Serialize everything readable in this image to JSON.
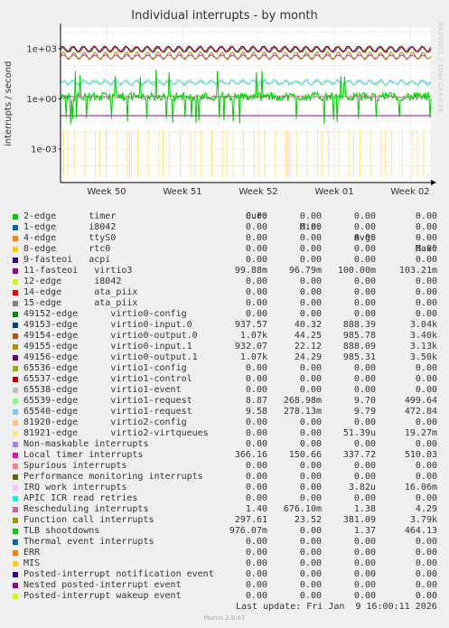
{
  "chart_data": {
    "type": "line",
    "title": "Individual interrupts - by month",
    "side_text": "RRDTOOL / TOBI OETIKER",
    "ylabel": "interrupts / second",
    "yscale": "log",
    "ylim": [
      1e-05,
      20000
    ],
    "y_ticks": [
      {
        "value": 1000,
        "label": "1e+03"
      },
      {
        "value": 1,
        "label": "1e+00"
      },
      {
        "value": 0.001,
        "label": "1e-03"
      }
    ],
    "x_ticks": [
      "Week 50",
      "Week 51",
      "Week 52",
      "Week 01",
      "Week 02"
    ],
    "grid": true,
    "columns": [
      "Cur:",
      "Min:",
      "Avg:",
      "Max:"
    ],
    "series": [
      {
        "name": "2-edge      timer",
        "color": "#00cc00",
        "cur": "0.00",
        "min": "0.00",
        "avg": "0.00",
        "max": "0.00"
      },
      {
        "name": "1-edge      i8042",
        "color": "#0066b3",
        "cur": "0.00",
        "min": "0.00",
        "avg": "0.00",
        "max": "0.00"
      },
      {
        "name": "4-edge      ttyS0",
        "color": "#ff8000",
        "cur": "0.00",
        "min": "0.00",
        "avg": "0.00",
        "max": "0.00"
      },
      {
        "name": "8-edge      rtc0",
        "color": "#ffcc00",
        "cur": "0.00",
        "min": "0.00",
        "avg": "0.00",
        "max": "0.00"
      },
      {
        "name": "9-fasteoi   acpi",
        "color": "#330099",
        "cur": "0.00",
        "min": "0.00",
        "avg": "0.00",
        "max": "0.00"
      },
      {
        "name": "11-fasteoi   virtio3",
        "color": "#990099",
        "cur": "99.88m",
        "min": "96.79m",
        "avg": "100.00m",
        "max": "103.21m"
      },
      {
        "name": "12-edge      i8042",
        "color": "#ccff00",
        "cur": "0.00",
        "min": "0.00",
        "avg": "0.00",
        "max": "0.00"
      },
      {
        "name": "14-edge      ata_piix",
        "color": "#ff0000",
        "cur": "0.00",
        "min": "0.00",
        "avg": "0.00",
        "max": "0.00"
      },
      {
        "name": "15-edge      ata_piix",
        "color": "#808080",
        "cur": "0.00",
        "min": "0.00",
        "avg": "0.00",
        "max": "0.00"
      },
      {
        "name": "49152-edge      virtio0-config",
        "color": "#008f00",
        "cur": "0.00",
        "min": "0.00",
        "avg": "0.00",
        "max": "0.00"
      },
      {
        "name": "49153-edge      virtio0-input.0",
        "color": "#00487d",
        "cur": "937.57",
        "min": "40.32",
        "avg": "888.39",
        "max": "3.04k"
      },
      {
        "name": "49154-edge      virtio0-output.0",
        "color": "#b35a00",
        "cur": "1.07k",
        "min": "44.25",
        "avg": "985.78",
        "max": "3.40k"
      },
      {
        "name": "49155-edge      virtio0-input.1",
        "color": "#b38f00",
        "cur": "932.07",
        "min": "22.12",
        "avg": "888.09",
        "max": "3.13k"
      },
      {
        "name": "49156-edge      virtio0-output.1",
        "color": "#6b006b",
        "cur": "1.07k",
        "min": "24.29",
        "avg": "985.31",
        "max": "3.50k"
      },
      {
        "name": "65536-edge      virtio1-config",
        "color": "#8fb300",
        "cur": "0.00",
        "min": "0.00",
        "avg": "0.00",
        "max": "0.00"
      },
      {
        "name": "65537-edge      virtio1-control",
        "color": "#b30000",
        "cur": "0.00",
        "min": "0.00",
        "avg": "0.00",
        "max": "0.00"
      },
      {
        "name": "65538-edge      virtio1-event",
        "color": "#bebebe",
        "cur": "0.00",
        "min": "0.00",
        "avg": "0.00",
        "max": "0.00"
      },
      {
        "name": "65539-edge      virtio1-request",
        "color": "#80ff80",
        "cur": "8.87",
        "min": "268.98m",
        "avg": "9.70",
        "max": "499.64"
      },
      {
        "name": "65540-edge      virtio1-request",
        "color": "#80c9ff",
        "cur": "9.58",
        "min": "278.13m",
        "avg": "9.79",
        "max": "472.84"
      },
      {
        "name": "81920-edge      virtio2-config",
        "color": "#ffc080",
        "cur": "0.00",
        "min": "0.00",
        "avg": "0.00",
        "max": "0.00"
      },
      {
        "name": "81921-edge      virtio2-virtqueues",
        "color": "#ffe680",
        "cur": "0.00",
        "min": "0.00",
        "avg": "51.39u",
        "max": "19.27m"
      },
      {
        "name": "Non-maskable interrupts",
        "color": "#aa80ff",
        "cur": "0.00",
        "min": "0.00",
        "avg": "0.00",
        "max": "0.00"
      },
      {
        "name": "Local timer interrupts",
        "color": "#ee00cc",
        "cur": "366.16",
        "min": "150.66",
        "avg": "337.72",
        "max": "510.03"
      },
      {
        "name": "Spurious interrupts",
        "color": "#ff8080",
        "cur": "0.00",
        "min": "0.00",
        "avg": "0.00",
        "max": "0.00"
      },
      {
        "name": "Performance monitoring interrupts",
        "color": "#666600",
        "cur": "0.00",
        "min": "0.00",
        "avg": "0.00",
        "max": "0.00"
      },
      {
        "name": "IRQ work interrupts",
        "color": "#ffbfff",
        "cur": "0.00",
        "min": "0.00",
        "avg": "3.82u",
        "max": "16.06m"
      },
      {
        "name": "APIC ICR read retries",
        "color": "#00ffcc",
        "cur": "0.00",
        "min": "0.00",
        "avg": "0.00",
        "max": "0.00"
      },
      {
        "name": "Rescheduling interrupts",
        "color": "#cc6699",
        "cur": "1.40",
        "min": "676.10m",
        "avg": "1.38",
        "max": "4.29"
      },
      {
        "name": "Function call interrupts",
        "color": "#999900",
        "cur": "297.61",
        "min": "23.52",
        "avg": "381.09",
        "max": "3.79k"
      },
      {
        "name": "TLB shootdowns",
        "color": "#00cc00",
        "cur": "976.07m",
        "min": "0.00",
        "avg": "1.37",
        "max": "464.13"
      },
      {
        "name": "Thermal event interrupts",
        "color": "#0066b3",
        "cur": "0.00",
        "min": "0.00",
        "avg": "0.00",
        "max": "0.00"
      },
      {
        "name": "ERR",
        "color": "#ff8000",
        "cur": "0.00",
        "min": "0.00",
        "avg": "0.00",
        "max": "0.00"
      },
      {
        "name": "MIS",
        "color": "#ffcc00",
        "cur": "0.00",
        "min": "0.00",
        "avg": "0.00",
        "max": "0.00"
      },
      {
        "name": "Posted-interrupt notification event",
        "color": "#330099",
        "cur": "0.00",
        "min": "0.00",
        "avg": "0.00",
        "max": "0.00"
      },
      {
        "name": "Nested posted-interrupt event",
        "color": "#990099",
        "cur": "0.00",
        "min": "0.00",
        "avg": "0.00",
        "max": "0.00"
      },
      {
        "name": "Posted-interrupt wakeup event",
        "color": "#ccff00",
        "cur": "0.00",
        "min": "0.00",
        "avg": "0.00",
        "max": "0.00"
      }
    ]
  },
  "footer": {
    "last_update": "Last update: Fri Jan  9 16:00:11 2026",
    "munin": "Munin 2.0.67"
  }
}
